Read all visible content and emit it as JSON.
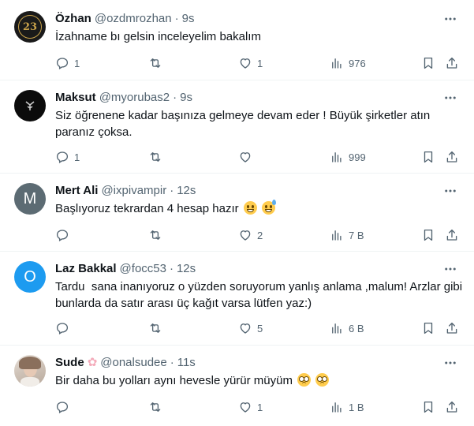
{
  "tweets": [
    {
      "name": "Özhan",
      "handle": "@ozdmrozhan",
      "time": "9s",
      "text": "İzahname bı gelsin inceleyelim bakalım",
      "avatar_label": "23",
      "avatar_bg": "#1a1a1a",
      "avatar_fg": "#c9a24a",
      "replies": "1",
      "retweets": "",
      "likes": "1",
      "views": "976"
    },
    {
      "name": "Maksut",
      "handle": "@myorubas2",
      "time": "9s",
      "text": "Siz öğrenene kadar başınıza gelmeye devam eder ! Büyük şirketler atın paranız çoksa.",
      "avatar_bg": "#0b0b0b",
      "replies": "1",
      "retweets": "",
      "likes": "",
      "views": "999"
    },
    {
      "name": "Mert Ali",
      "handle": "@ixpivampir",
      "time": "12s",
      "text": "Başlıyoruz tekrardan 4 hesap hazır",
      "avatar_label": "M",
      "avatar_bg": "#5c6b73",
      "replies": "",
      "retweets": "",
      "likes": "2",
      "views": "7 B"
    },
    {
      "name": "Laz Bakkal",
      "handle": "@focc53",
      "time": "12s",
      "text": "Tardu  sana inanıyoruz o yüzden soruyorum yanlış anlama ,malum! Arzlar gibi bunlarda da satır arası üç kağıt varsa lütfen yaz:)",
      "avatar_label": "O",
      "avatar_bg": "#1d9bf0",
      "replies": "",
      "retweets": "",
      "likes": "5",
      "views": "6 B"
    },
    {
      "name": "Sude",
      "handle": "@onalsudee",
      "time": "11s",
      "text": "Bir daha bu yolları aynı hevesle yürür müyüm",
      "avatar_bg": "#d9cfc6",
      "replies": "",
      "retweets": "",
      "likes": "1",
      "views": "1 B"
    }
  ],
  "separator": "·",
  "colors": {
    "text": "#0f1419",
    "muted": "#536471",
    "border": "#eff3f4"
  }
}
